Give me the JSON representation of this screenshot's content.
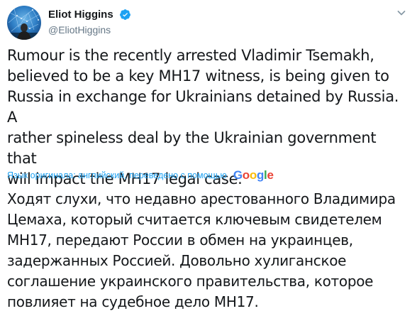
{
  "author": {
    "name": "Eliot Higgins",
    "handle": "@EliotHiggins",
    "verified": true
  },
  "tweet": {
    "text_lines": [
      "Rumour is the recently arrested Vladimir Tsemakh,",
      "believed to be a key MH17 witness, is being given to",
      "Russia in exchange for Ukrainians detained by Russia. A",
      "rather spineless deal by the Ukrainian government that",
      "will impact the MH17 legal case."
    ]
  },
  "translation": {
    "label": "Язык оригинала: английский, переведено с помощью",
    "provider": "Google",
    "text_lines": [
      "Ходят слухи, что недавно арестованного Владимира",
      "Цемаха, который считается ключевым свидетелем",
      "МН17, передают России в обмен на украинцев,",
      "задержанных Россией. Довольно хулиганское",
      "соглашение украинского правительства, которое",
      "повлияет на судебное дело МН17."
    ]
  },
  "icons": {
    "verified": "verified-badge-icon",
    "caret": "chevron-down-icon"
  },
  "colors": {
    "link": "#1da1f2",
    "secondary_text": "#657786",
    "primary_text": "#14171a",
    "verified_badge": "#1da1f2"
  }
}
